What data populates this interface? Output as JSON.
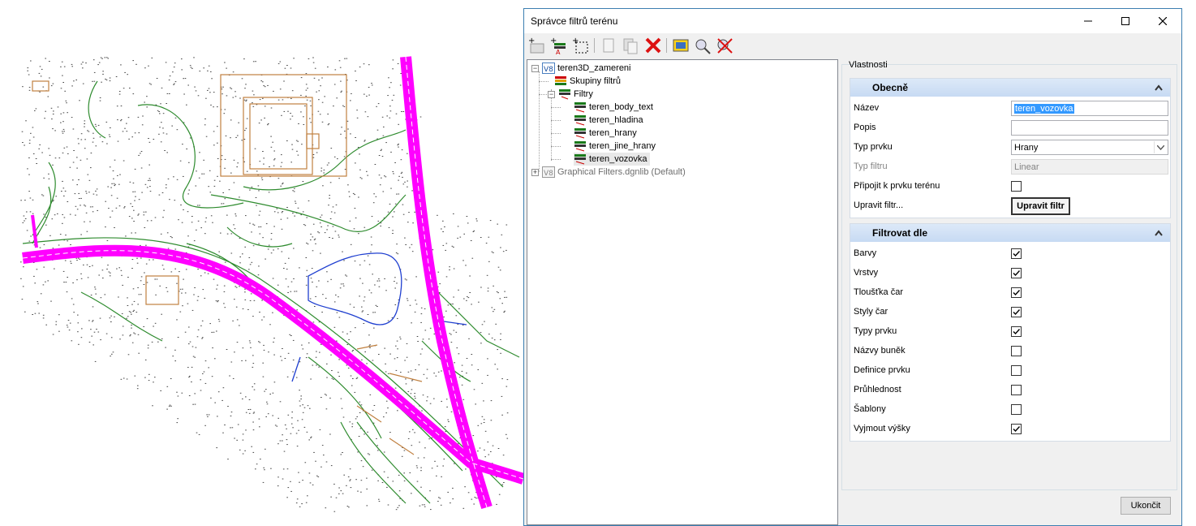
{
  "dialog": {
    "title": "Správce filtrů terénu",
    "window_buttons": {
      "minimize_icon": "minimize-icon",
      "maximize_icon": "maximize-icon",
      "close_icon": "close-icon"
    }
  },
  "toolbar": {
    "icons": [
      "new-group-icon",
      "new-filter-icon",
      "new-graphical-filter-icon",
      "copy-icon",
      "paste-icon",
      "delete-icon",
      "preview-icon",
      "zoom-icon",
      "clear-icon"
    ]
  },
  "tree": {
    "root": "teren3D_zamereni",
    "groups": "Skupiny filtrů",
    "filters_folder": "Filtry",
    "filters": [
      "teren_body_text",
      "teren_hladina",
      "teren_hrany",
      "teren_jine_hrany",
      "teren_vozovka"
    ],
    "selected": "teren_vozovka",
    "library": "Graphical Filters.dgnlib (Default)"
  },
  "properties": {
    "label": "Vlastnosti",
    "general": {
      "title": "Obecně",
      "name_label": "Název",
      "name_value": "teren_vozovka",
      "desc_label": "Popis",
      "desc_value": "",
      "type_label": "Typ prvku",
      "type_value": "Hrany",
      "filter_type_label": "Typ filtru",
      "filter_type_value": "Linear",
      "attach_label": "Připojit k prvku terénu",
      "attach_checked": false,
      "edit_label": "Upravit filtr...",
      "edit_button": "Upravit filtr"
    },
    "filter_by": {
      "title": "Filtrovat dle",
      "items": [
        {
          "label": "Barvy",
          "checked": true
        },
        {
          "label": "Vrstvy",
          "checked": true
        },
        {
          "label": "Tloušťka čar",
          "checked": true
        },
        {
          "label": "Styly čar",
          "checked": true
        },
        {
          "label": "Typy prvku",
          "checked": true
        },
        {
          "label": "Názvy buněk",
          "checked": false
        },
        {
          "label": "Definice prvku",
          "checked": false
        },
        {
          "label": "Průhlednost",
          "checked": false
        },
        {
          "label": "Šablony",
          "checked": false
        },
        {
          "label": "Vyjmout výšky",
          "checked": true
        }
      ]
    }
  },
  "footer": {
    "close_button": "Ukončit"
  },
  "colors": {
    "road": "#ff00ff",
    "terrain": "#2e8b2e",
    "water": "#1f3fd0",
    "building": "#c08040",
    "accent": "#3399ff"
  }
}
